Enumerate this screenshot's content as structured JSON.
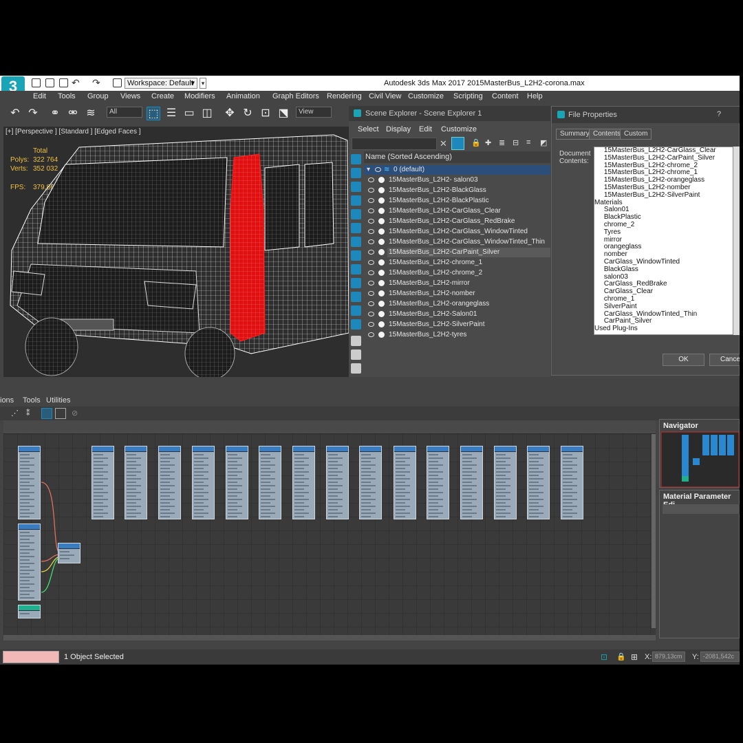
{
  "app": {
    "logo": "3",
    "title": "Autodesk 3ds Max 2017   2015MasterBus_L2H2-corona.max",
    "workspace_value": "Workspace: Default"
  },
  "menu": [
    "Edit",
    "Tools",
    "Group",
    "Views",
    "Create",
    "Modifiers",
    "Animation",
    "Graph Editors",
    "Rendering",
    "Civil View",
    "Customize",
    "Scripting",
    "Content",
    "Help"
  ],
  "toolbar": {
    "filter_value": "All",
    "refcoord_value": "View"
  },
  "viewport": {
    "label": "[+] [Perspective ] [Standard ] [Edged Faces ]",
    "stats_total_label": "Total",
    "polys_label": "Polys:",
    "polys_value": "322 764",
    "verts_label": "Verts:",
    "verts_value": "352 032",
    "fps_label": "FPS:",
    "fps_value": "379,867"
  },
  "scene_explorer": {
    "title": "Scene Explorer - Scene Explorer 1",
    "menu": [
      "Select",
      "Display",
      "Edit",
      "Customize"
    ],
    "column_header": "Name (Sorted Ascending)",
    "layer": "0 (default)",
    "items": [
      "15MasterBus_L2H2- salon03",
      "15MasterBus_L2H2-BlackGlass",
      "15MasterBus_L2H2-BlackPlastic",
      "15MasterBus_L2H2-CarGlass_Clear",
      "15MasterBus_L2H2-CarGlass_RedBrake",
      "15MasterBus_L2H2-CarGlass_WindowTinted",
      "15MasterBus_L2H2-CarGlass_WindowTinted_Thin",
      "15MasterBus_L2H2-CarPaint_Silver",
      "15MasterBus_L2H2-chrome_1",
      "15MasterBus_L2H2-chrome_2",
      "15MasterBus_L2H2-mirror",
      "15MasterBus_L2H2-nomber",
      "15MasterBus_L2H2-orangeglass",
      "15MasterBus_L2H2-Salon01",
      "15MasterBus_L2H2-SilverPaint",
      "15MasterBus_L2H2-tyres"
    ],
    "selected_index": 7
  },
  "file_properties": {
    "title": "File Properties",
    "help": "?",
    "tabs": [
      "Summary",
      "Contents",
      "Custom"
    ],
    "active_tab": 1,
    "doc_label_1": "Document",
    "doc_label_2": "Contents:",
    "contents": [
      "     15MasterBus_L2H2-CarGlass_Clear",
      "     15MasterBus_L2H2-CarPaint_Silver",
      "     15MasterBus_L2H2-chrome_2",
      "     15MasterBus_L2H2-chrome_1",
      "     15MasterBus_L2H2-orangeglass",
      "     15MasterBus_L2H2-nomber",
      "     15MasterBus_L2H2-SilverPaint",
      "Materials",
      "     Salon01",
      "     BlackPlastic",
      "     chrome_2",
      "     Tyres",
      "     mirror",
      "     orangeglass",
      "     nomber",
      "     CarGlass_WindowTinted",
      "     BlackGlass",
      "     salon03",
      "     CarGlass_RedBrake",
      "     CarGlass_Clear",
      "     chrome_1",
      "     SilverPaint",
      "     CarGlass_WindowTinted_Thin",
      "     CarPaint_Silver",
      "Used Plug-Ins"
    ],
    "ok_label": "OK",
    "cancel_label": "Cancel"
  },
  "slate": {
    "menu": [
      "ions",
      "Tools",
      "Utilities"
    ],
    "navigator_title": "Navigator",
    "matparam_title": "Material Parameter Edi"
  },
  "status": {
    "text": "1 Object Selected",
    "x_label": "X:",
    "x_value": "879,13cm",
    "y_label": "Y:",
    "y_value": "-2081,542c"
  },
  "colors": {
    "accent": "#1aa4b5",
    "selection_red": "#e01010",
    "node_header": "#3a7cc0"
  }
}
